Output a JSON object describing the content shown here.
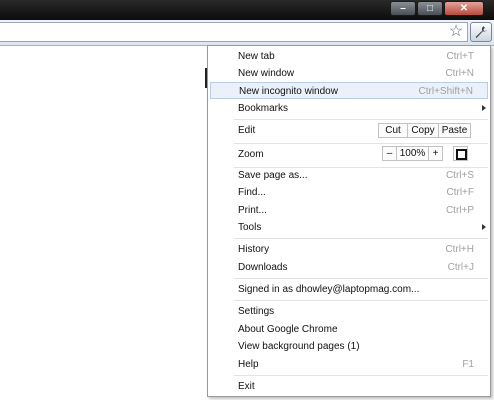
{
  "window_controls": {
    "minimize_glyph": "–",
    "maximize_glyph": "□",
    "close_glyph": "✕"
  },
  "toolbar": {
    "star_glyph": "☆",
    "wrench_icon": "wrench-icon"
  },
  "menu": {
    "new_tab": {
      "label": "New tab",
      "shortcut": "Ctrl+T"
    },
    "new_window": {
      "label": "New window",
      "shortcut": "Ctrl+N"
    },
    "new_incognito": {
      "label": "New incognito window",
      "shortcut": "Ctrl+Shift+N"
    },
    "bookmarks": {
      "label": "Bookmarks"
    },
    "edit": {
      "label": "Edit",
      "cut": "Cut",
      "copy": "Copy",
      "paste": "Paste"
    },
    "zoom": {
      "label": "Zoom",
      "minus": "–",
      "level": "100%",
      "plus": "+"
    },
    "save_page": {
      "label": "Save page as...",
      "shortcut": "Ctrl+S"
    },
    "find": {
      "label": "Find...",
      "shortcut": "Ctrl+F"
    },
    "print": {
      "label": "Print...",
      "shortcut": "Ctrl+P"
    },
    "tools": {
      "label": "Tools"
    },
    "history": {
      "label": "History",
      "shortcut": "Ctrl+H"
    },
    "downloads": {
      "label": "Downloads",
      "shortcut": "Ctrl+J"
    },
    "signed_in": {
      "label": "Signed in as dhowley@laptopmag.com..."
    },
    "settings": {
      "label": "Settings"
    },
    "about": {
      "label": "About Google Chrome"
    },
    "background_pages": {
      "label": "View background pages (1)"
    },
    "help": {
      "label": "Help",
      "shortcut": "F1"
    },
    "exit": {
      "label": "Exit"
    }
  }
}
